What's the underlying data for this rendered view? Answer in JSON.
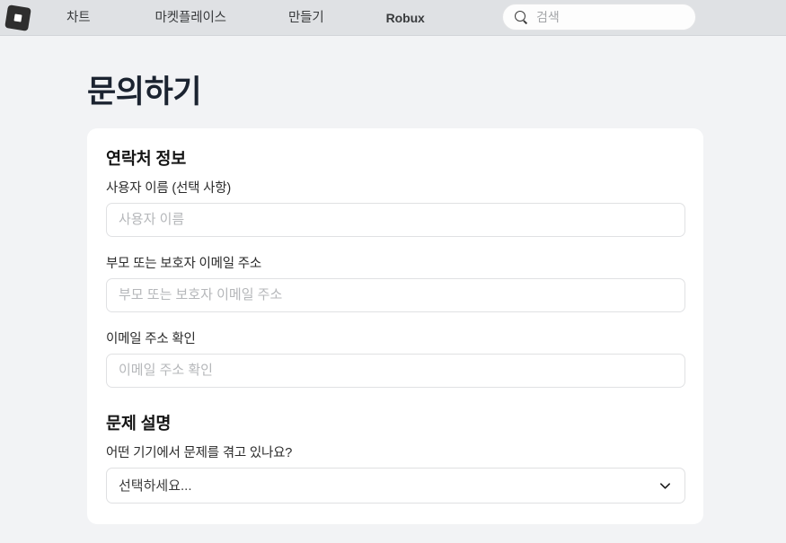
{
  "header": {
    "logo_icon": "roblox-logo-icon",
    "nav_items": [
      {
        "label": "차트"
      },
      {
        "label": "마켓플레이스"
      },
      {
        "label": "만들기"
      },
      {
        "label": "Robux"
      }
    ],
    "search": {
      "icon": "search-icon",
      "placeholder": "검색",
      "value": ""
    }
  },
  "page": {
    "title": "문의하기"
  },
  "form": {
    "contact_section": {
      "heading": "연락처 정보",
      "fields": [
        {
          "label": "사용자 이름 (선택 사항)",
          "placeholder": "사용자 이름",
          "value": ""
        },
        {
          "label": "부모 또는 보호자 이메일 주소",
          "placeholder": "부모 또는 보호자 이메일 주소",
          "value": ""
        },
        {
          "label": "이메일 주소 확인",
          "placeholder": "이메일 주소 확인",
          "value": ""
        }
      ]
    },
    "problem_section": {
      "heading": "문제 설명",
      "device_label": "어떤 기기에서 문제를 겪고 있나요?",
      "device_select": {
        "selected": "선택하세요...",
        "icon": "chevron-down-icon"
      }
    }
  },
  "colors": {
    "header_bg": "#dfe1e4",
    "page_bg": "#f2f3f5",
    "card_bg": "#ffffff",
    "title_color": "#1b2330",
    "border": "#e0e1e3"
  }
}
